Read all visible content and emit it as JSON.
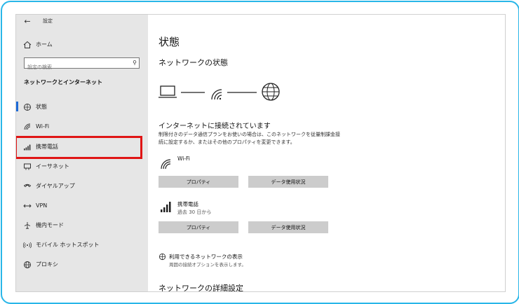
{
  "window": {
    "title": "設定",
    "back_icon": "back-arrow-icon"
  },
  "sidebar": {
    "home_label": "ホーム",
    "search_placeholder": "設定の検索",
    "section_title": "ネットワークとインターネット",
    "items": [
      {
        "label": "状態",
        "icon": "status-icon",
        "active": true
      },
      {
        "label": "Wi-Fi",
        "icon": "wifi-icon"
      },
      {
        "label": "携帯電話",
        "icon": "cellular-icon",
        "highlighted": true
      },
      {
        "label": "イーサネット",
        "icon": "ethernet-icon"
      },
      {
        "label": "ダイヤルアップ",
        "icon": "dialup-icon"
      },
      {
        "label": "VPN",
        "icon": "vpn-icon"
      },
      {
        "label": "機内モード",
        "icon": "airplane-icon"
      },
      {
        "label": "モバイル ホットスポット",
        "icon": "hotspot-icon"
      },
      {
        "label": "プロキシ",
        "icon": "proxy-icon"
      }
    ]
  },
  "main": {
    "title": "状態",
    "network_status_heading": "ネットワークの状態",
    "connection_title": "インターネットに接続されています",
    "connection_desc": "制限付きのデータ通信プランをお使いの場合は、このネットワークを従量制課金接続に設定するか、またはその他のプロパティを変更できます。",
    "adapters": [
      {
        "name": "Wi-Fi",
        "sub": "",
        "properties_label": "プロパティ",
        "data_usage_label": "データ使用状況"
      },
      {
        "name": "携帯電話",
        "sub": "過去 30 日から",
        "properties_label": "プロパティ",
        "data_usage_label": "データ使用状況"
      }
    ],
    "available_networks_title": "利用できるネットワークの表示",
    "available_networks_sub": "周囲の接続オプションを表示します。",
    "advanced_heading": "ネットワークの詳細設定"
  },
  "colors": {
    "frame": "#29b6e8",
    "highlight": "#e01515",
    "accent": "#1d6ad6",
    "sidebar_bg": "#e6e6e6",
    "button_bg": "#cccccc"
  }
}
